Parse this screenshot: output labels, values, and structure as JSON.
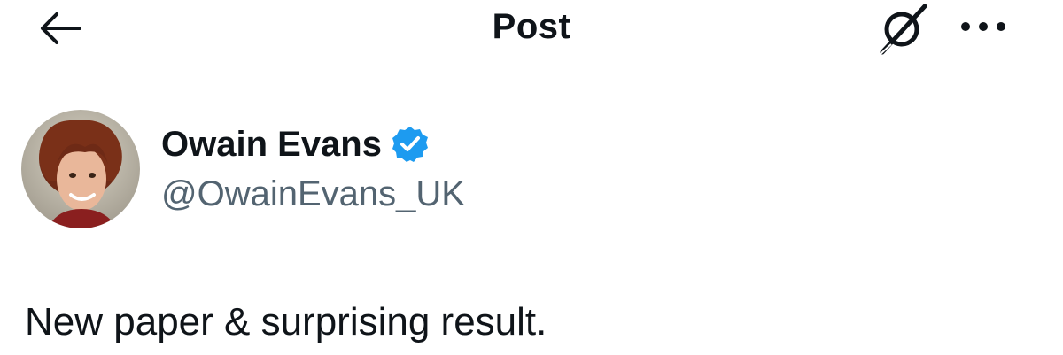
{
  "header": {
    "title": "Post",
    "back_icon": "arrow-left-icon",
    "grok_icon": "grok-icon",
    "more_icon": "more-horizontal-icon"
  },
  "author": {
    "display_name": "Owain Evans",
    "handle": "@OwainEvans_UK",
    "verified": true,
    "verified_icon": "verified-badge-icon",
    "verified_color": "#1d9bf0"
  },
  "post": {
    "text": "New paper & surprising result."
  },
  "colors": {
    "text_primary": "#0f1419",
    "text_secondary": "#536471",
    "background": "#ffffff"
  }
}
